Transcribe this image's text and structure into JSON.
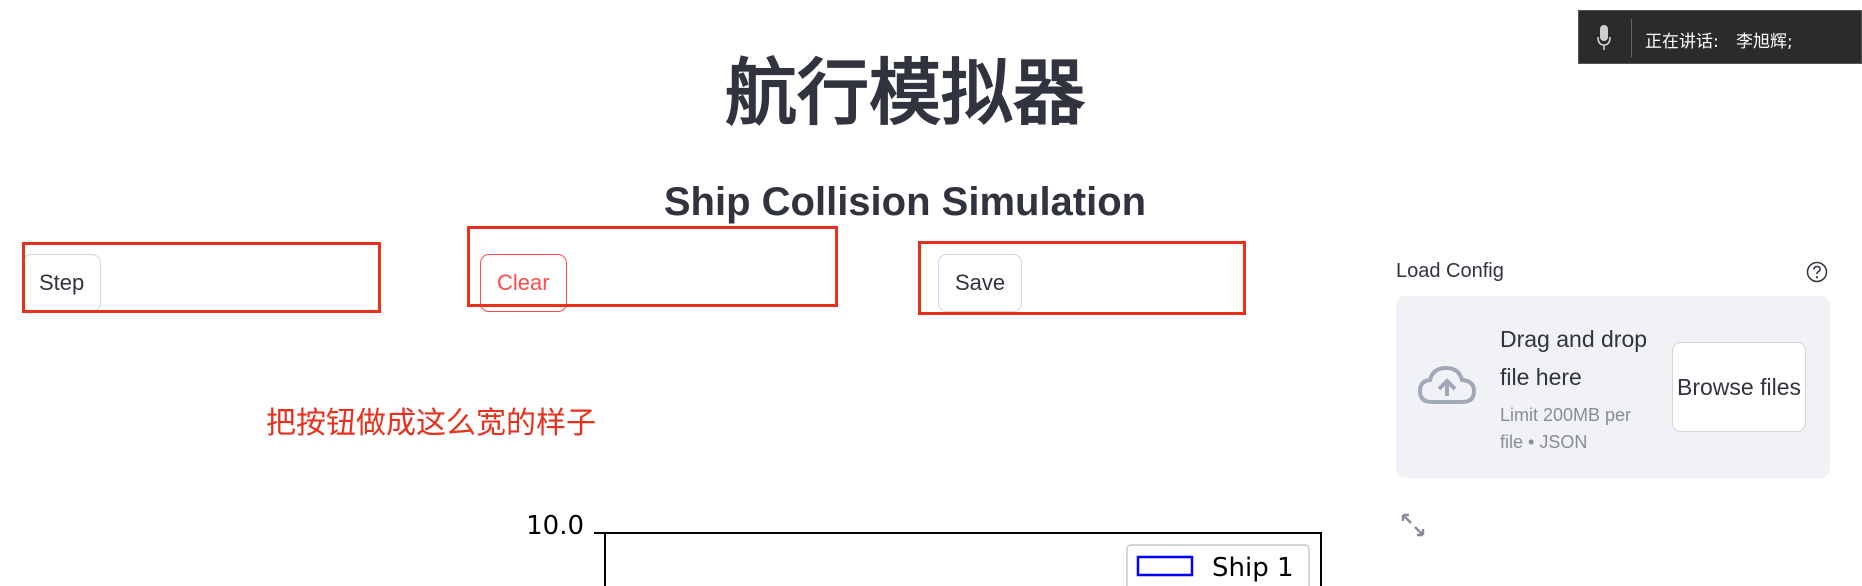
{
  "main_title": "航行模拟器",
  "speaking_indicator": {
    "label": "正在讲话:",
    "name": "李旭辉;",
    "icon": "microphone-icon"
  },
  "subtitle": "Ship Collision Simulation",
  "buttons": {
    "step": "Step",
    "clear": "Clear",
    "save": "Save"
  },
  "annotation": "把按钮做成这么宽的样子",
  "uploader": {
    "label": "Load Config",
    "drop_text": "Drag and drop file here",
    "limit_text": "Limit 200MB per file • JSON",
    "browse_label": "Browse files",
    "icons": [
      "help-icon",
      "cloud-upload-icon",
      "expand-icon"
    ]
  },
  "colors": {
    "accent_red": "#ff4b4b",
    "annotation_red": "#e8301c",
    "ship_blue": "#0000ff"
  },
  "chart_data": {
    "type": "scatter",
    "y_tick_labels": [
      "10.0"
    ],
    "ylim_top": 10.0,
    "legend": [
      "Ship 1"
    ],
    "legend_placement": "top-right",
    "series": [
      {
        "name": "Ship 1",
        "color": "#0000ff",
        "values": []
      }
    ]
  }
}
